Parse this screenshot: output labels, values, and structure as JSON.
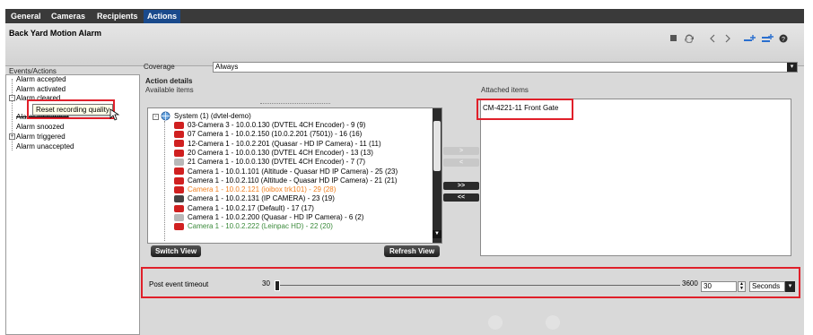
{
  "tabs": [
    {
      "label": "General",
      "active": false
    },
    {
      "label": "Cameras",
      "active": false
    },
    {
      "label": "Recipients",
      "active": false
    },
    {
      "label": "Actions",
      "active": true
    }
  ],
  "alarm_title": "Back Yard Motion Alarm",
  "toolbar_icons": [
    "stop-icon",
    "refresh-icon",
    "previous-icon",
    "next-icon",
    "add-before-icon",
    "add-after-icon",
    "help-icon"
  ],
  "left_panel": {
    "label": "Events/Actions",
    "events": [
      "Alarm accepted",
      "Alarm activated",
      "Alarm cleared",
      "Alarm forwarded",
      "Alarm snoozed",
      "Alarm triggered",
      "Alarm unaccepted"
    ],
    "tooltip": "Reset recording quality"
  },
  "coverage": {
    "label": "Coverage",
    "value": "Always"
  },
  "action_details": {
    "title": "Action details",
    "available_label": "Available items",
    "attached_label": "Attached items",
    "root": "System (1) (dvtel-demo)",
    "available_items": [
      {
        "text": "03-Camera 3 - 10.0.0.130 (DVTEL 4CH Encoder) - 9 (9)",
        "icon": "camera-red",
        "color": "#000000"
      },
      {
        "text": "07 Camera 1 - 10.0.2.150 (10.0.2.201 (7501)) - 16 (16)",
        "icon": "camera-red",
        "color": "#000000"
      },
      {
        "text": "12-Camera 1 - 10.0.2.201 (Quasar - HD IP Camera) - 11 (11)",
        "icon": "camera-red",
        "color": "#000000"
      },
      {
        "text": "20 Camera 1 - 10.0.0.130 (DVTEL 4CH Encoder) - 13 (13)",
        "icon": "camera-red",
        "color": "#000000"
      },
      {
        "text": "21 Camera 1 - 10.0.0.130 (DVTEL 4CH Encoder) - 7 (7)",
        "icon": "camera-gray",
        "color": "#000000"
      },
      {
        "text": "Camera 1 - 10.0.1.101 (Altitude - Quasar HD IP Camera) - 25 (23)",
        "icon": "camera-red",
        "color": "#000000"
      },
      {
        "text": "Camera 1 - 10.0.2.110 (Altitude - Quasar HD IP Camera) - 21 (21)",
        "icon": "camera-red",
        "color": "#000000"
      },
      {
        "text": "Camera 1 - 10.0.2.121 (ioibox trk101) - 29 (28)",
        "icon": "camera-red",
        "color": "#f08020"
      },
      {
        "text": "Camera 1 - 10.0.2.131 (IP CAMERA) - 23 (19)",
        "icon": "camera-dark",
        "color": "#000000"
      },
      {
        "text": "Camera 1 - 10.0.2.17 (Default) - 17 (17)",
        "icon": "camera-red",
        "color": "#000000"
      },
      {
        "text": "Camera 1 - 10.0.2.200 (Quasar - HD IP Camera) - 6 (2)",
        "icon": "camera-gray",
        "color": "#000000"
      },
      {
        "text": "Camera 1 - 10.0.2.222 (Leinpac HD) - 22 (20)",
        "icon": "camera-red",
        "color": "#3a8a3a"
      }
    ],
    "move_buttons": [
      ">",
      "<",
      ">>",
      "<<"
    ],
    "attached_items": [
      "CM-4221-11 Front Gate"
    ],
    "switch_view_label": "Switch View",
    "refresh_view_label": "Refresh View"
  },
  "post_event": {
    "label": "Post event timeout",
    "min": "30",
    "max": "3600",
    "value": "30",
    "slider_fraction": 0,
    "units": "Seconds"
  },
  "colors": {
    "highlight_box": "#e0202a",
    "active_tab": "#1a4a8c",
    "header_bar": "#3a3a3a"
  }
}
